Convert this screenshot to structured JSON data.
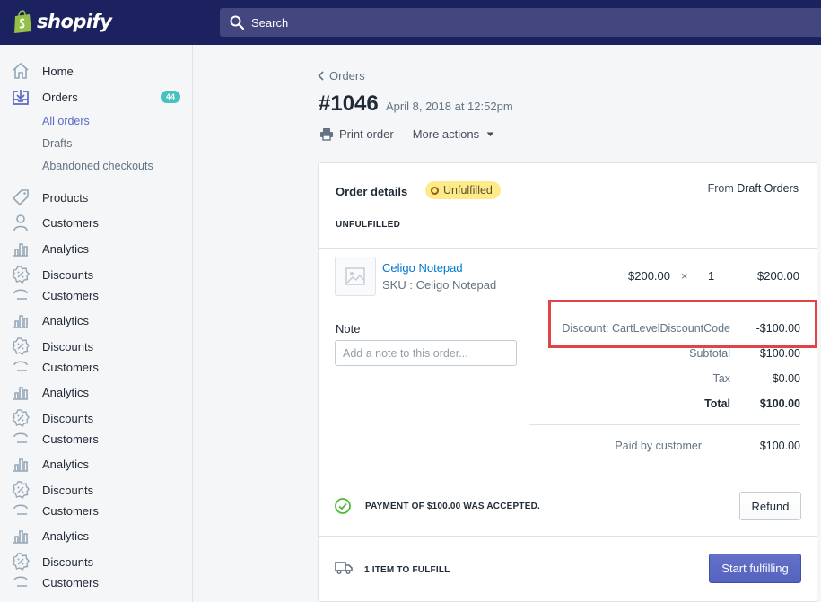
{
  "topbar": {
    "brand": "shopify",
    "search_label": "Search"
  },
  "sidebar": {
    "home": "Home",
    "orders": "Orders",
    "orders_badge": "44",
    "all_orders": "All orders",
    "drafts": "Drafts",
    "abandoned": "Abandoned checkouts",
    "products": "Products",
    "customers": "Customers",
    "analytics": "Analytics",
    "discounts": "Discounts"
  },
  "header": {
    "breadcrumb": "Orders",
    "order_number": "#1046",
    "order_date": "April 8, 2018 at 12:52pm",
    "print_order": "Print order",
    "more_actions": "More actions"
  },
  "card": {
    "title": "Order details",
    "status": "Unfulfilled",
    "from_prefix": "From",
    "from_source": "Draft Orders",
    "section_label": "UNFULFILLED",
    "item": {
      "name": "Celigo Notepad",
      "sku": "SKU : Celigo Notepad",
      "price": "$200.00",
      "times": "×",
      "qty": "1",
      "total": "$200.00"
    },
    "note_label": "Note",
    "note_placeholder": "Add a note to this order...",
    "summary": {
      "discount_label": "Discount: CartLevelDiscountCode",
      "discount_value": "-$100.00",
      "subtotal_label": "Subtotal",
      "subtotal_value": "$100.00",
      "tax_label": "Tax",
      "tax_value": "$0.00",
      "total_label": "Total",
      "total_value": "$100.00",
      "paid_label": "Paid by customer",
      "paid_value": "$100.00"
    },
    "payment_text": "PAYMENT OF $100.00 WAS ACCEPTED.",
    "refund_label": "Refund",
    "fulfill_text": "1 ITEM TO FULFILL",
    "start_fulfilling_label": "Start fulfilling"
  },
  "colors": {
    "topbar": "#1c2260",
    "accent": "#5c6ac4",
    "badge": "#47c1bf",
    "status_pill": "#ffea8a",
    "highlight": "#e14448"
  }
}
